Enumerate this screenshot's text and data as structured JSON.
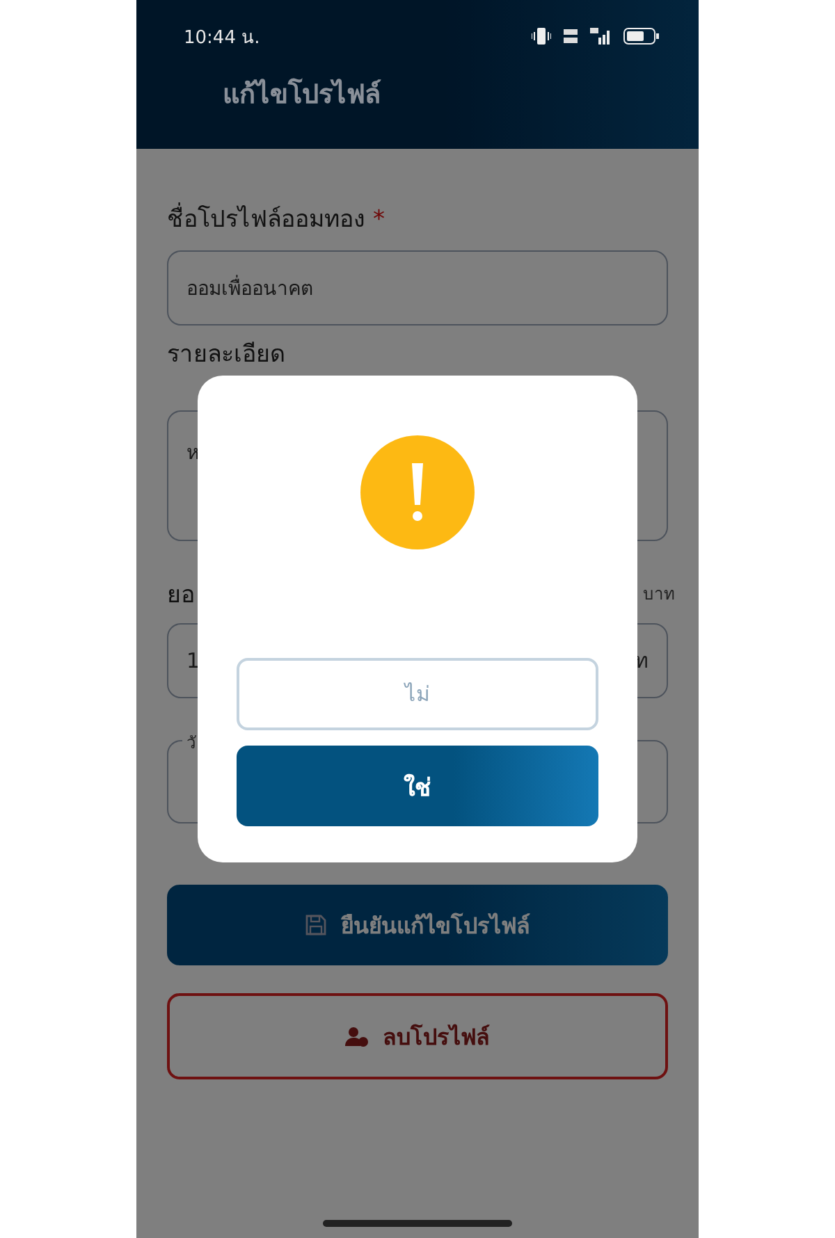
{
  "status_bar": {
    "time": "10:44 น."
  },
  "header": {
    "title": "แก้ไขโปรไฟล์"
  },
  "form": {
    "name": {
      "label": "ชื่อโปรไฟล์ออมทอง",
      "required_mark": "*",
      "value": "ออมเพื่ออนาคต"
    },
    "description": {
      "label": "รายละเอียด",
      "value": "ห"
    },
    "amount": {
      "label": "ยอ",
      "unit_label": "บาท",
      "value": "1",
      "suffix": "ท"
    },
    "date": {
      "label": "วั"
    },
    "buttons": [
      {
        "kind": "primary",
        "label": "ยืนยันแก้ไขโปรไฟล์"
      },
      {
        "kind": "danger",
        "label": "ลบโปรไฟล์"
      }
    ]
  },
  "dialog": {
    "buttons": [
      {
        "kind": "secondary",
        "label": "ไม่"
      },
      {
        "kind": "primary",
        "label": "ใช่"
      }
    ]
  }
}
